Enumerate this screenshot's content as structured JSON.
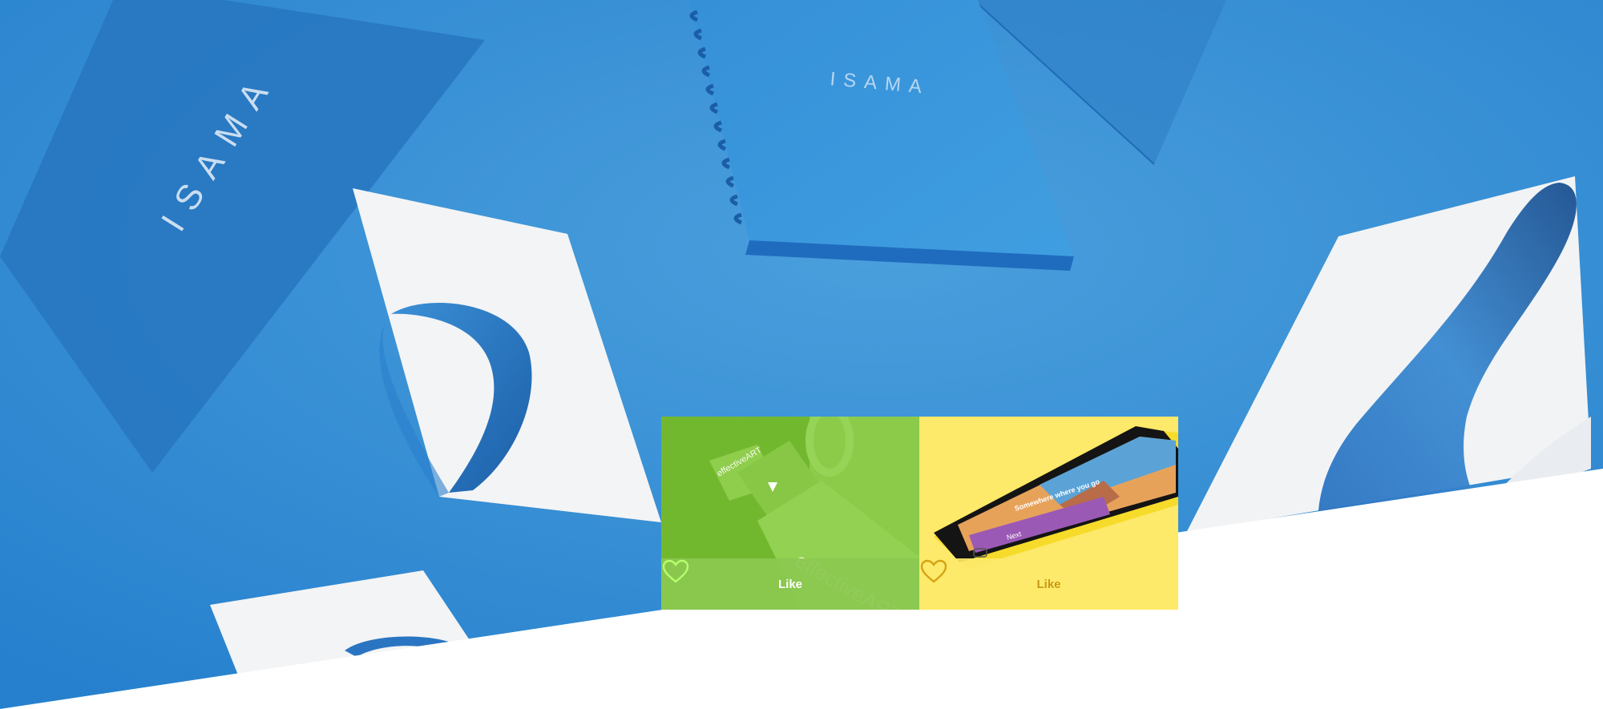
{
  "hero": {
    "brand_logo_text": "ISAMA",
    "background_color": "#2f87cf",
    "accent_color": "#1f72c0"
  },
  "cards": [
    {
      "theme": "green",
      "color": "#7cc138",
      "brand_text": "effectiveART",
      "like_label": "Like",
      "like_icon": "heart-icon"
    },
    {
      "theme": "yellow",
      "color": "#fde96a",
      "phone_caption": "Somewhere where you go",
      "phone_button_label": "Next",
      "like_label": "Like",
      "like_icon": "heart-icon"
    }
  ]
}
